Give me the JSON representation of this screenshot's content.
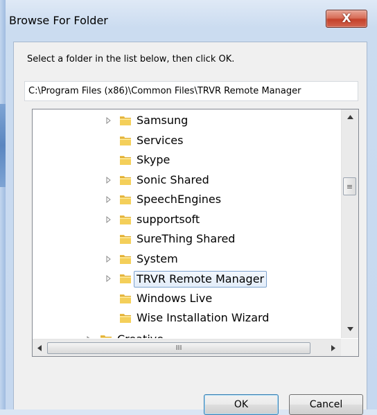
{
  "window": {
    "title": "Browse For Folder",
    "close_symbol": "X"
  },
  "instruction": "Select a folder in the list below, then click OK.",
  "path": "C:\\Program Files (x86)\\Common Files\\TRVR Remote Manager",
  "tree": {
    "items": [
      {
        "label": "Samsung",
        "expandable": true
      },
      {
        "label": "Services",
        "expandable": false
      },
      {
        "label": "Skype",
        "expandable": false
      },
      {
        "label": "Sonic Shared",
        "expandable": true
      },
      {
        "label": "SpeechEngines",
        "expandable": true
      },
      {
        "label": "supportsoft",
        "expandable": true
      },
      {
        "label": "SureThing Shared",
        "expandable": false
      },
      {
        "label": "System",
        "expandable": true
      },
      {
        "label": "TRVR Remote Manager",
        "expandable": true,
        "selected": true
      },
      {
        "label": "Windows Live",
        "expandable": false
      },
      {
        "label": "Wise Installation Wizard",
        "expandable": false
      }
    ],
    "parent_item": {
      "label": "Creative",
      "expandable": true
    },
    "vscroll_grip": "≡",
    "hscroll_grip": "III"
  },
  "buttons": {
    "ok": "OK",
    "cancel": "Cancel"
  }
}
